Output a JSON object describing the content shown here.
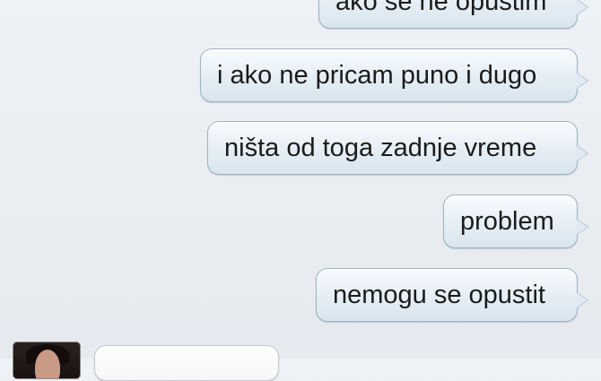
{
  "messages": [
    {
      "text": "ako se ne opustim",
      "direction": "outgoing"
    },
    {
      "text": "i ako ne pricam puno i dugo",
      "direction": "outgoing"
    },
    {
      "text": "ništa od toga zadnje vreme",
      "direction": "outgoing"
    },
    {
      "text": "problem",
      "direction": "outgoing"
    },
    {
      "text": "nemogu se opustit",
      "direction": "outgoing"
    },
    {
      "text": "",
      "direction": "incoming"
    }
  ],
  "colors": {
    "background": "#eef1f5",
    "outgoing_bubble": "#e5eef5",
    "outgoing_border": "#9fb2c4",
    "incoming_bubble": "#ffffff",
    "text": "#1b1b1b"
  }
}
